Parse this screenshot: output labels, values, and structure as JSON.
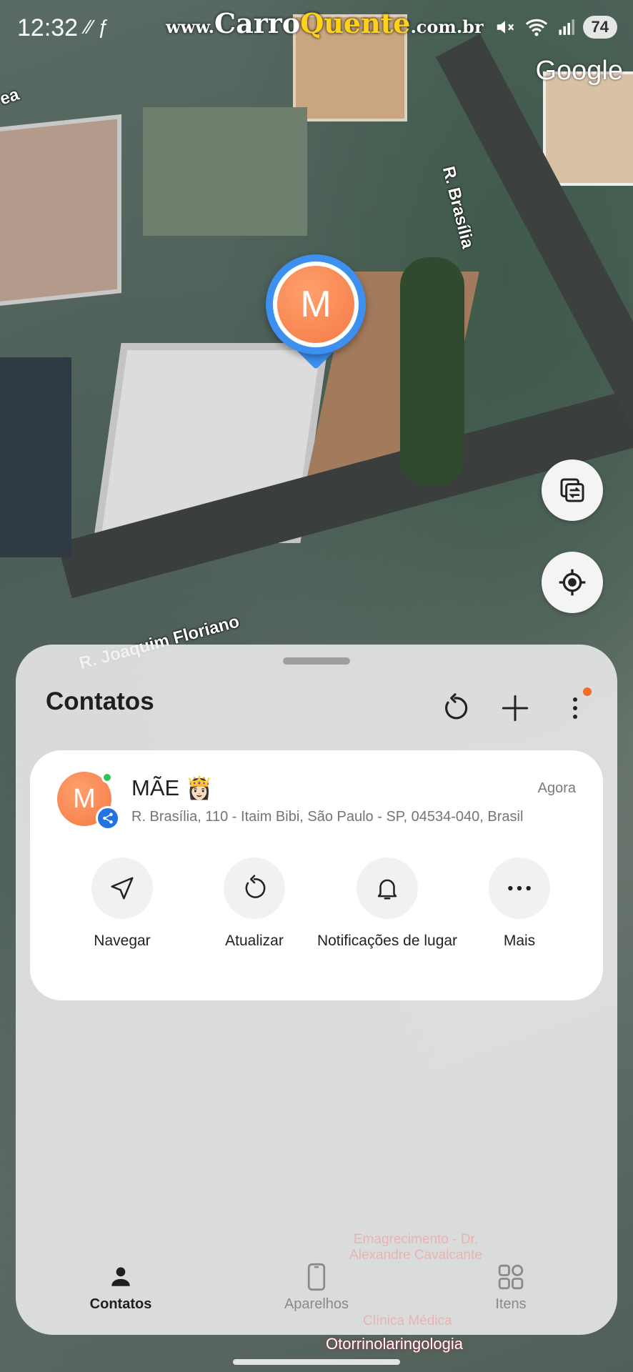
{
  "status_bar": {
    "time": "12:32",
    "left_icons": "⁄⁄ ƒ",
    "watermark_prefix": "www.",
    "watermark_carro": "Carro",
    "watermark_quente": "Quente",
    "watermark_suffix": ".com.br",
    "battery": "74"
  },
  "map": {
    "street_1": "R. Brasília",
    "street_2": "R. Joaquim Floriano",
    "street_3": "ea",
    "google": "Google",
    "pin_initial": "M"
  },
  "sheet": {
    "title": "Contatos",
    "contact": {
      "initial": "M",
      "name": "MÃE 👸🏻",
      "time": "Agora",
      "address": "R. Brasília, 110 - Itaim Bibi, São Paulo - SP, 04534-040, Brasil"
    },
    "actions": [
      {
        "label": "Navegar"
      },
      {
        "label": "Atualizar"
      },
      {
        "label": "Notificações de lugar"
      },
      {
        "label": "Mais"
      }
    ],
    "tabs": [
      {
        "label": "Contatos",
        "active": true
      },
      {
        "label": "Aparelhos"
      },
      {
        "label": "Itens"
      }
    ],
    "poi_1": "Emagrecimento - Dr. Alexandre Cavalcante",
    "poi_2": "Clínica Médica"
  },
  "bottom_poi": "Otorrinolaringologia",
  "colors": {
    "pin_ring": "#3d8ff0",
    "avatar": "#f47a45",
    "online": "#2ec654",
    "notification_dot": "#f46b2c"
  }
}
